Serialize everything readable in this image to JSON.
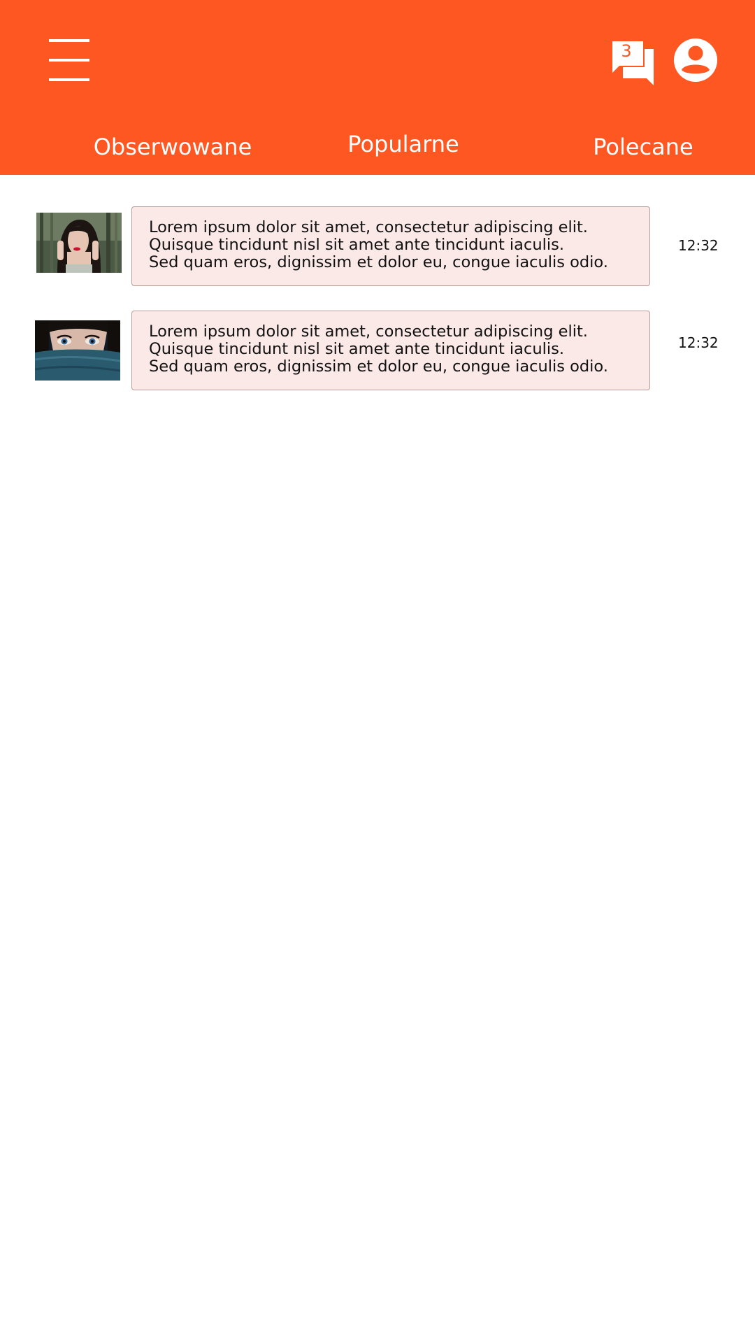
{
  "header": {
    "background_color": "#ff5722",
    "menu_icon": "hamburger-menu-icon",
    "chat_icon": "chat-bubbles-icon",
    "chat_badge_count": "3",
    "profile_icon": "account-circle-icon"
  },
  "tabs": [
    {
      "label": "Obserwowane"
    },
    {
      "label": "Popularne"
    },
    {
      "label": "Polecane"
    }
  ],
  "messages": [
    {
      "avatar": "photo-woman-red-lips",
      "lines": [
        "Lorem ipsum dolor sit amet, consectetur adipiscing elit.",
        "Quisque tincidunt nisl sit amet ante tincidunt iaculis.",
        "Sed quam eros, dignissim et dolor eu, congue iaculis odio."
      ],
      "time": "12:32"
    },
    {
      "avatar": "photo-woman-blue-eyes",
      "lines": [
        "Lorem ipsum dolor sit amet, consectetur adipiscing elit.",
        "Quisque tincidunt nisl sit amet ante tincidunt iaculis.",
        "Sed quam eros, dignissim et dolor eu, congue iaculis odio."
      ],
      "time": "12:32"
    }
  ],
  "colors": {
    "accent": "#ff5722",
    "bubble_background": "#fbe9e7",
    "bubble_border": "#b79e9a",
    "text": "#111111"
  }
}
